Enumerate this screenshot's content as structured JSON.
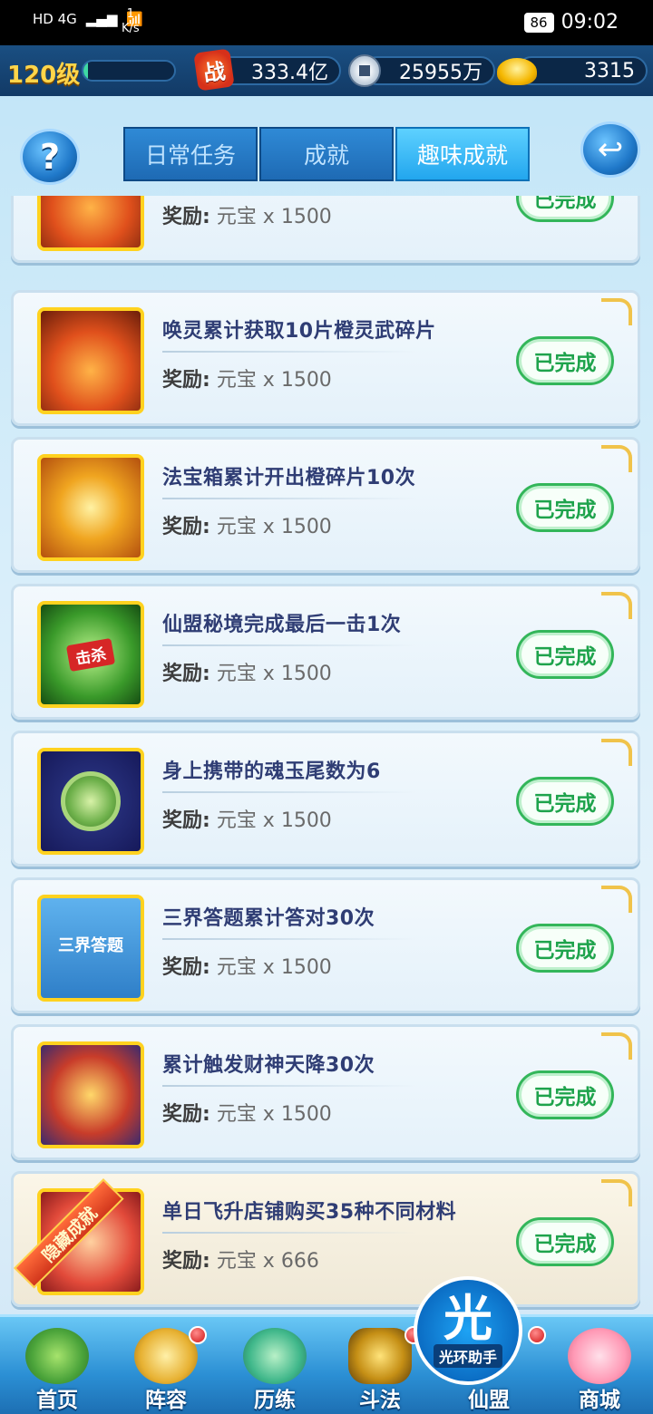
{
  "status_bar": {
    "network": "HD 4G",
    "speed_value": "1",
    "speed_unit": "K/s",
    "battery": "86",
    "time": "09:02"
  },
  "resources": {
    "level": "120级",
    "exp_fraction": 0.05,
    "combat_icon_label": "战",
    "combat_power": "333.4亿",
    "copper": "25955万",
    "ingots": "3315"
  },
  "header": {
    "help_label": "?",
    "back_icon": "back-arrow-icon",
    "tabs": [
      {
        "label": "日常任务",
        "active": false
      },
      {
        "label": "成就",
        "active": false
      },
      {
        "label": "趣味成就",
        "active": true
      }
    ]
  },
  "achievements": [
    {
      "title": "",
      "reward": "元宝 x 1500",
      "status": "已完成",
      "thumb": "fire-warrior-icon"
    },
    {
      "title": "唤灵累计获取10片橙灵武碎片",
      "reward": "元宝 x 1500",
      "status": "已完成",
      "thumb": "fire-warrior-icon"
    },
    {
      "title": "法宝箱累计开出橙碎片10次",
      "reward": "元宝 x 1500",
      "status": "已完成",
      "thumb": "treasure-chest-icon"
    },
    {
      "title": "仙盟秘境完成最后一击1次",
      "reward": "元宝 x 1500",
      "status": "已完成",
      "thumb": "bull-demon-icon",
      "thumb_badge": "击杀"
    },
    {
      "title": "身上携带的魂玉尾数为6",
      "reward": "元宝 x 1500",
      "status": "已完成",
      "thumb": "jade-swirl-icon"
    },
    {
      "title": "三界答题累计答对30次",
      "reward": "元宝 x 1500",
      "status": "已完成",
      "thumb": "quiz-girl-icon",
      "thumb_badge": "三界答题"
    },
    {
      "title": "累计触发财神天降30次",
      "reward": "元宝 x 1500",
      "status": "已完成",
      "thumb": "god-of-wealth-icon"
    },
    {
      "title": "单日飞升店铺购买35种不同材料",
      "reward": "元宝 x 666",
      "status": "已完成",
      "thumb": "shop-icon",
      "ribbon": "隐藏成就"
    }
  ],
  "reward_label": "奖励:",
  "bottom_nav": [
    {
      "label": "首页",
      "icon": "home-island-icon",
      "dot": false
    },
    {
      "label": "阵容",
      "icon": "lineup-icon",
      "dot": true
    },
    {
      "label": "历练",
      "icon": "training-icon",
      "dot": false
    },
    {
      "label": "斗法",
      "icon": "battle-sword-icon",
      "dot": true
    },
    {
      "label": "仙盟",
      "icon": "guild-icon",
      "dot": true
    },
    {
      "label": "商城",
      "icon": "shop-mall-icon",
      "dot": false
    }
  ],
  "halo_assistant": {
    "big": "光",
    "small": "光环助手"
  },
  "colors": {
    "done_green": "#1ea34c",
    "title_blue": "#2f3d74",
    "tab_active": "#22a6ee",
    "level_gold": "#ffd54a"
  }
}
